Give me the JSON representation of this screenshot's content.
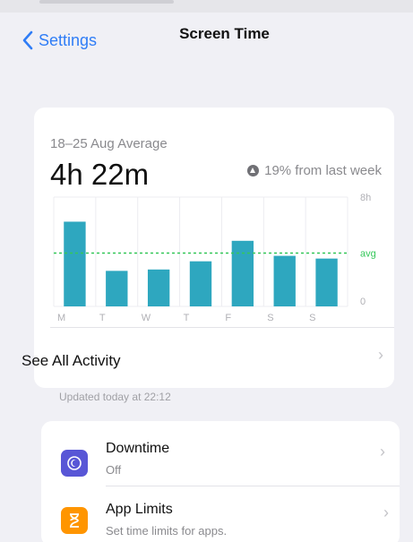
{
  "nav": {
    "back_label": "Settings",
    "title": "Screen Time"
  },
  "summary": {
    "period": "18–25 Aug Average",
    "total": "4h 22m",
    "delta": "19% from last week"
  },
  "chart_data": {
    "type": "bar",
    "categories": [
      "M",
      "T",
      "W",
      "T",
      "F",
      "S",
      "S"
    ],
    "values": [
      6.2,
      2.6,
      2.7,
      3.3,
      4.8,
      3.7,
      3.5
    ],
    "average": 3.9,
    "ylim": [
      0,
      8
    ],
    "y_tick_labels": [
      "8h",
      "avg",
      "0"
    ],
    "bar_color": "#2ea7bf",
    "avg_color": "#34c759",
    "grid": true
  },
  "see_all": "See All Activity",
  "updated": "Updated today at 22:12",
  "list": [
    {
      "title": "Downtime",
      "subtitle": "Off",
      "icon": "moon-icon",
      "color": "#5856d6"
    },
    {
      "title": "App Limits",
      "subtitle": "Set time limits for apps.",
      "icon": "hourglass-icon",
      "color": "#ff9500"
    }
  ]
}
